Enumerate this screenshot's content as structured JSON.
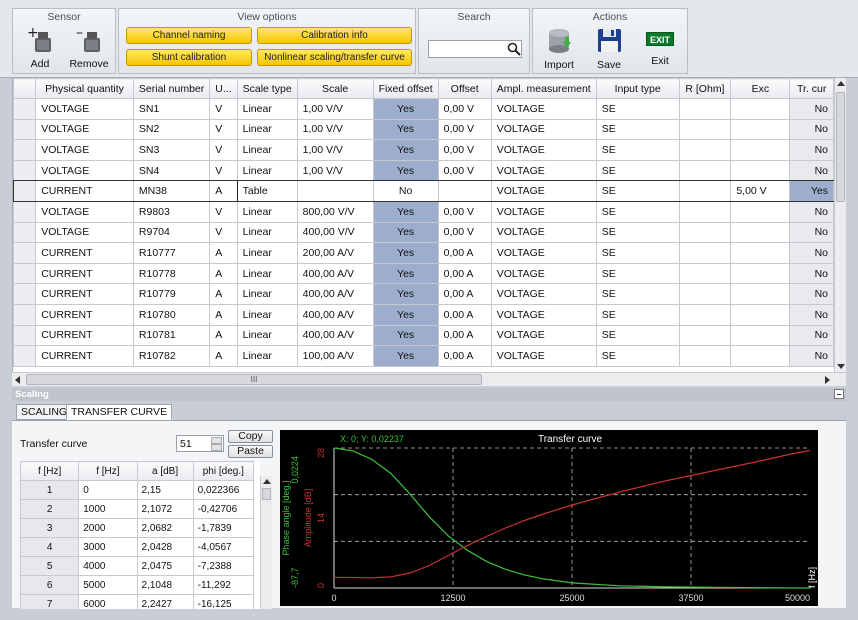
{
  "ribbon": {
    "sensor": {
      "title": "Sensor",
      "add": "Add",
      "remove": "Remove"
    },
    "view": {
      "title": "View options",
      "channel_naming": "Channel naming",
      "calibration_info": "Calibration info",
      "shunt_calibration": "Shunt calibration",
      "nonlinear": "Nonlinear scaling/transfer curve"
    },
    "search": {
      "title": "Search",
      "value": ""
    },
    "actions": {
      "title": "Actions",
      "import": "Import",
      "save": "Save",
      "exit": "Exit",
      "exit_badge": "EXIT"
    }
  },
  "grid": {
    "columns": [
      "Physical quantity",
      "Serial number",
      "U...",
      "Scale type",
      "Scale",
      "Fixed offset",
      "Offset",
      "Ampl. measurement",
      "Input type",
      "R [Ohm]",
      "Exc",
      "Tr. cur"
    ],
    "rows": [
      [
        "VOLTAGE",
        "SN1",
        "V",
        "Linear",
        "1,00 V/V",
        "Yes",
        "0,00 V",
        "VOLTAGE",
        "SE",
        "",
        "",
        "No"
      ],
      [
        "VOLTAGE",
        "SN2",
        "V",
        "Linear",
        "1,00 V/V",
        "Yes",
        "0,00 V",
        "VOLTAGE",
        "SE",
        "",
        "",
        "No"
      ],
      [
        "VOLTAGE",
        "SN3",
        "V",
        "Linear",
        "1,00 V/V",
        "Yes",
        "0,00 V",
        "VOLTAGE",
        "SE",
        "",
        "",
        "No"
      ],
      [
        "VOLTAGE",
        "SN4",
        "V",
        "Linear",
        "1,00 V/V",
        "Yes",
        "0,00 V",
        "VOLTAGE",
        "SE",
        "",
        "",
        "No"
      ],
      [
        "CURRENT",
        "MN38",
        "A",
        "Table",
        "",
        "No",
        "",
        "VOLTAGE",
        "SE",
        "",
        "5,00 V",
        "Yes"
      ],
      [
        "VOLTAGE",
        "R9803",
        "V",
        "Linear",
        "800,00 V/V",
        "Yes",
        "0,00 V",
        "VOLTAGE",
        "SE",
        "",
        "",
        "No"
      ],
      [
        "VOLTAGE",
        "R9704",
        "V",
        "Linear",
        "400,00 V/V",
        "Yes",
        "0,00 V",
        "VOLTAGE",
        "SE",
        "",
        "",
        "No"
      ],
      [
        "CURRENT",
        "R10777",
        "A",
        "Linear",
        "200,00 A/V",
        "Yes",
        "0,00 A",
        "VOLTAGE",
        "SE",
        "",
        "",
        "No"
      ],
      [
        "CURRENT",
        "R10778",
        "A",
        "Linear",
        "400,00 A/V",
        "Yes",
        "0,00 A",
        "VOLTAGE",
        "SE",
        "",
        "",
        "No"
      ],
      [
        "CURRENT",
        "R10779",
        "A",
        "Linear",
        "400,00 A/V",
        "Yes",
        "0,00 A",
        "VOLTAGE",
        "SE",
        "",
        "",
        "No"
      ],
      [
        "CURRENT",
        "R10780",
        "A",
        "Linear",
        "400,00 A/V",
        "Yes",
        "0,00 A",
        "VOLTAGE",
        "SE",
        "",
        "",
        "No"
      ],
      [
        "CURRENT",
        "R10781",
        "A",
        "Linear",
        "400,00 A/V",
        "Yes",
        "0,00 A",
        "VOLTAGE",
        "SE",
        "",
        "",
        "No"
      ],
      [
        "CURRENT",
        "R10782",
        "A",
        "Linear",
        "100,00 A/V",
        "Yes",
        "0,00 A",
        "VOLTAGE",
        "SE",
        "",
        "",
        "No"
      ]
    ],
    "hscroll_label": "III"
  },
  "scaling": {
    "title": "Scaling",
    "tabs": [
      "SCALING",
      "TRANSFER CURVE"
    ],
    "transfer_label": "Transfer curve",
    "points": "51",
    "copy": "Copy",
    "paste": "Paste",
    "table_columns": [
      "f [Hz]",
      "f [Hz]",
      "a [dB]",
      "phi [deg.]"
    ],
    "table_rows": [
      [
        "1",
        "0",
        "2,15",
        "0,022366"
      ],
      [
        "2",
        "1000",
        "2,1072",
        "-0,42706"
      ],
      [
        "3",
        "2000",
        "2,0682",
        "-1,7839"
      ],
      [
        "4",
        "3000",
        "2,0428",
        "-4,0567"
      ],
      [
        "5",
        "4000",
        "2,0475",
        "-7,2388"
      ],
      [
        "6",
        "5000",
        "2,1048",
        "-11,292"
      ],
      [
        "7",
        "6000",
        "2,2427",
        "-16,125"
      ]
    ]
  },
  "chart_data": {
    "type": "line",
    "title": "Transfer curve",
    "cursor": "X: 0; Y: 0,02237",
    "xlabel": "f [Hz]",
    "ylabel_left": "Phase angle [deg.]",
    "ylabel_right": "Amplitude [dB]",
    "xlim": [
      0,
      50000
    ],
    "x_ticks": [
      "0",
      "12500",
      "25000",
      "37500",
      "50000"
    ],
    "phase_ticks": [
      "0,0224",
      "-87,7"
    ],
    "amp_ticks": [
      "28",
      "14",
      "0"
    ],
    "grid": true,
    "series": [
      {
        "name": "Phase angle [deg.]",
        "color": "#3fbf3f",
        "x": [
          0,
          2000,
          4000,
          6000,
          8000,
          10000,
          12000,
          14000,
          16000,
          18000,
          20000,
          22000,
          25000,
          30000,
          35000,
          40000,
          45000,
          50000
        ],
        "values": [
          0.02,
          -1.8,
          -7.2,
          -16,
          -29,
          -43,
          -55,
          -64,
          -71,
          -76,
          -79.5,
          -82,
          -84.5,
          -86.3,
          -87,
          -87.3,
          -87.5,
          -87.7
        ]
      },
      {
        "name": "Amplitude [dB]",
        "color": "#c83232",
        "x": [
          0,
          4000,
          6000,
          8000,
          10000,
          12000,
          14000,
          16000,
          18000,
          20000,
          22000,
          25000,
          30000,
          35000,
          40000,
          45000,
          48000,
          50000
        ],
        "values": [
          2.15,
          2.05,
          2.24,
          3.0,
          4.5,
          6.5,
          8.5,
          10.3,
          12,
          13.5,
          14.8,
          16.6,
          19.2,
          21.5,
          23.5,
          25.5,
          26.8,
          27.5
        ]
      }
    ]
  }
}
